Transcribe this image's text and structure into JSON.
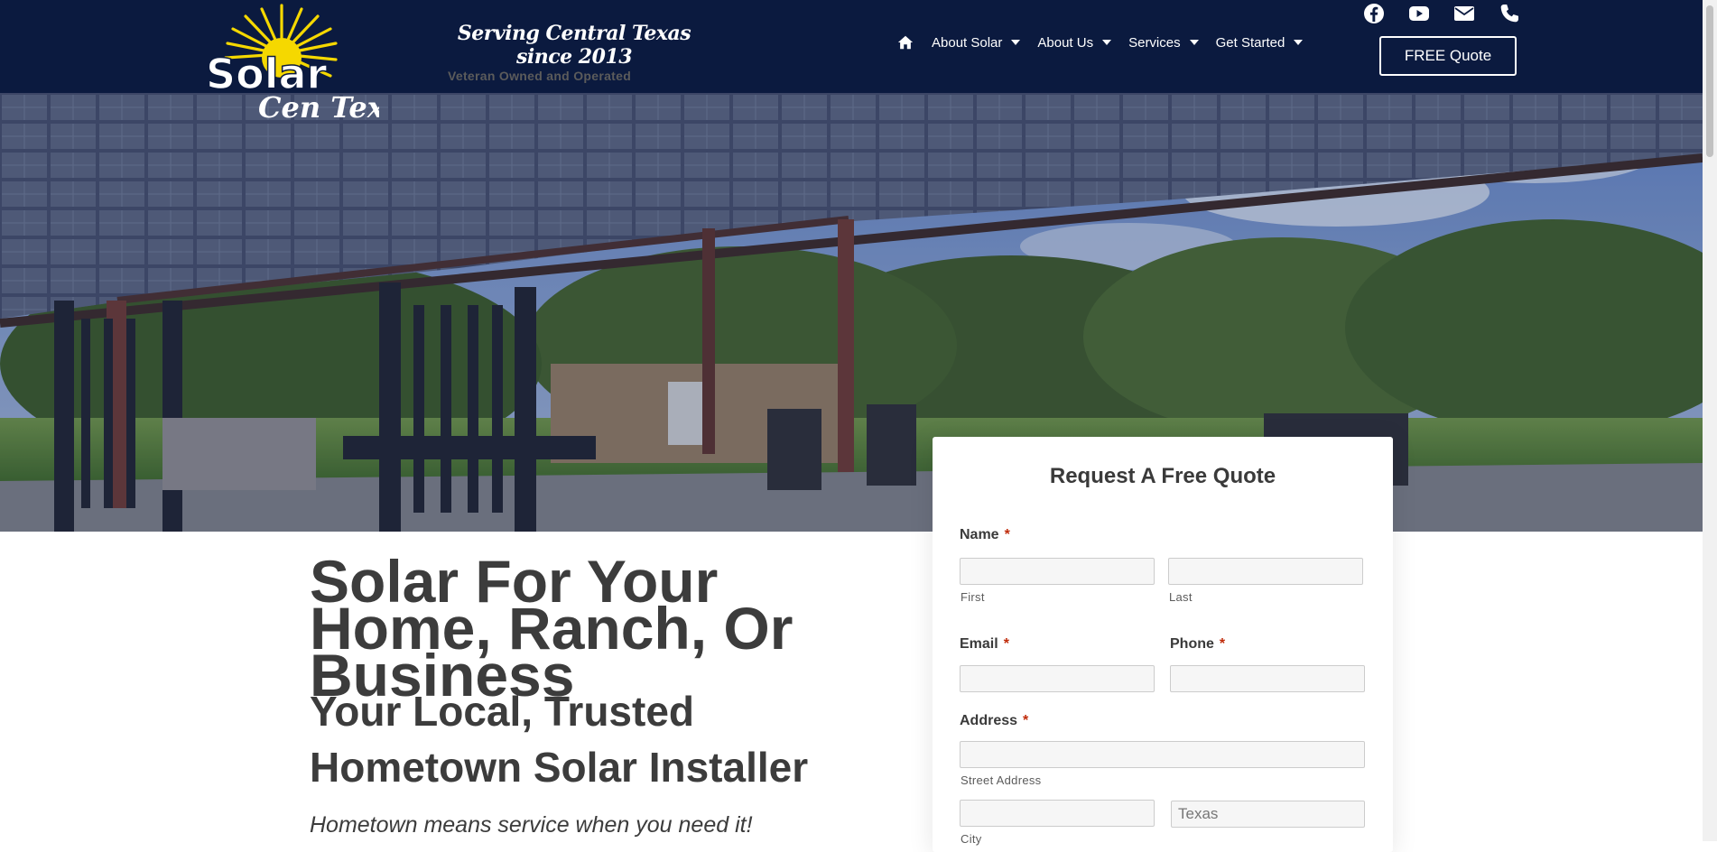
{
  "header": {
    "tagline_script": "Serving Central Texas since 2013",
    "tagline_sub": "Veteran Owned and Operated",
    "logo_text_main": "Solar",
    "logo_text_script": "Cen Tex",
    "nav": [
      {
        "label": "About Solar"
      },
      {
        "label": "About Us"
      },
      {
        "label": "Services"
      },
      {
        "label": "Get Started"
      }
    ],
    "cta_label": "FREE Quote",
    "social_icons": [
      "facebook-icon",
      "youtube-icon",
      "email-icon",
      "phone-icon"
    ]
  },
  "hero": {
    "heading": "Solar For Your Home, Ranch, Or Business",
    "subheading": "Your Local, Trusted Hometown Solar Installer",
    "lead": "Hometown means service when you need it!"
  },
  "form": {
    "title": "Request A Free Quote",
    "name_label": "Name",
    "first_sublabel": "First",
    "last_sublabel": "Last",
    "email_label": "Email",
    "phone_label": "Phone",
    "address_label": "Address",
    "street_sublabel": "Street Address",
    "city_sublabel": "City",
    "state_value": "Texas",
    "required_mark": "*"
  },
  "colors": {
    "header_bg": "#0b1a3f",
    "logo_yellow": "#f5d800",
    "required": "#c02b0a"
  }
}
